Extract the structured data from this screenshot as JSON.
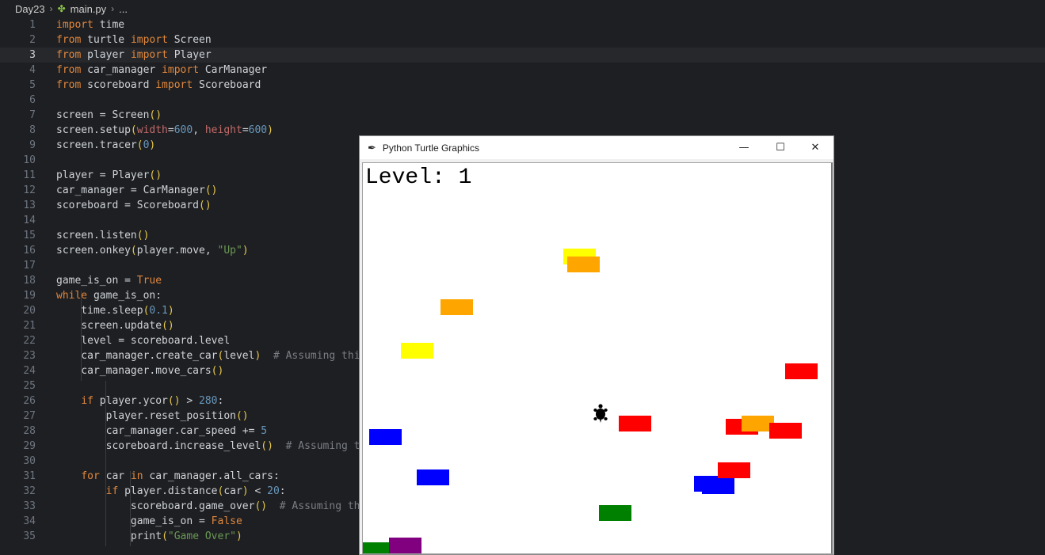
{
  "breadcrumb": {
    "folder": "Day23",
    "file": "main.py",
    "more": "..."
  },
  "editor": {
    "current_line": 3,
    "lines": [
      [
        [
          "import",
          "kw"
        ],
        [
          " time",
          ""
        ]
      ],
      [
        [
          "from",
          "kw"
        ],
        [
          " turtle ",
          ""
        ],
        [
          "import",
          "kw"
        ],
        [
          " Screen",
          ""
        ]
      ],
      [
        [
          "from",
          "kw"
        ],
        [
          " player ",
          ""
        ],
        [
          "import",
          "kw"
        ],
        [
          " Player",
          ""
        ]
      ],
      [
        [
          "from",
          "kw"
        ],
        [
          " car_manager ",
          ""
        ],
        [
          "import",
          "kw"
        ],
        [
          " CarManager",
          ""
        ]
      ],
      [
        [
          "from",
          "kw"
        ],
        [
          " scoreboard ",
          ""
        ],
        [
          "import",
          "kw"
        ],
        [
          " Scoreboard",
          ""
        ]
      ],
      [],
      [
        [
          "screen = Screen",
          ""
        ],
        [
          "()",
          "par"
        ]
      ],
      [
        [
          "screen.setup",
          ""
        ],
        [
          "(",
          "par"
        ],
        [
          "width",
          "prm"
        ],
        [
          "=",
          ""
        ],
        [
          "600",
          "num"
        ],
        [
          ", ",
          ""
        ],
        [
          "height",
          "prm"
        ],
        [
          "=",
          ""
        ],
        [
          "600",
          "num"
        ],
        [
          ")",
          "par"
        ]
      ],
      [
        [
          "screen.tracer",
          ""
        ],
        [
          "(",
          "par"
        ],
        [
          "0",
          "num"
        ],
        [
          ")",
          "par"
        ]
      ],
      [],
      [
        [
          "player = Player",
          ""
        ],
        [
          "()",
          "par"
        ]
      ],
      [
        [
          "car_manager = CarManager",
          ""
        ],
        [
          "()",
          "par"
        ]
      ],
      [
        [
          "scoreboard = Scoreboard",
          ""
        ],
        [
          "()",
          "par"
        ]
      ],
      [],
      [
        [
          "screen.listen",
          ""
        ],
        [
          "()",
          "par"
        ]
      ],
      [
        [
          "screen.onkey",
          ""
        ],
        [
          "(",
          "par"
        ],
        [
          "player.move, ",
          ""
        ],
        [
          "\"Up\"",
          "str"
        ],
        [
          ")",
          "par"
        ]
      ],
      [],
      [
        [
          "game_is_on = ",
          ""
        ],
        [
          "True",
          "kw"
        ]
      ],
      [
        [
          "while",
          "kw"
        ],
        [
          " game_is_on:",
          ""
        ]
      ],
      [
        [
          "    time.sleep",
          ""
        ],
        [
          "(",
          "par"
        ],
        [
          "0.1",
          "num"
        ],
        [
          ")",
          "par"
        ]
      ],
      [
        [
          "    screen.update",
          ""
        ],
        [
          "()",
          "par"
        ]
      ],
      [
        [
          "    level = scoreboard.level",
          ""
        ]
      ],
      [
        [
          "    car_manager.create_car",
          ""
        ],
        [
          "(",
          "par"
        ],
        [
          "level",
          ""
        ],
        [
          ")",
          "par"
        ],
        [
          "  # Assuming this",
          "cmt"
        ]
      ],
      [
        [
          "    car_manager.move_cars",
          ""
        ],
        [
          "()",
          "par"
        ]
      ],
      [],
      [
        [
          "    ",
          ""
        ],
        [
          "if",
          "kw"
        ],
        [
          " player.ycor",
          ""
        ],
        [
          "()",
          "par"
        ],
        [
          " > ",
          ""
        ],
        [
          "280",
          "num"
        ],
        [
          ":",
          ""
        ]
      ],
      [
        [
          "        player.reset_position",
          ""
        ],
        [
          "()",
          "par"
        ]
      ],
      [
        [
          "        car_manager.car_speed += ",
          ""
        ],
        [
          "5",
          "num"
        ]
      ],
      [
        [
          "        scoreboard.increase_level",
          ""
        ],
        [
          "()",
          "par"
        ],
        [
          "  # Assuming th",
          "cmt"
        ]
      ],
      [],
      [
        [
          "    ",
          ""
        ],
        [
          "for",
          "kw"
        ],
        [
          " car ",
          ""
        ],
        [
          "in",
          "kw"
        ],
        [
          " car_manager.all_cars:",
          ""
        ]
      ],
      [
        [
          "        ",
          ""
        ],
        [
          "if",
          "kw"
        ],
        [
          " player.distance",
          ""
        ],
        [
          "(",
          "par"
        ],
        [
          "car",
          ""
        ],
        [
          ")",
          "par"
        ],
        [
          " < ",
          ""
        ],
        [
          "20",
          "num"
        ],
        [
          ":",
          ""
        ]
      ],
      [
        [
          "            scoreboard.game_over",
          ""
        ],
        [
          "()",
          "par"
        ],
        [
          "  # Assuming thi",
          "cmt"
        ]
      ],
      [
        [
          "            game_is_on = ",
          ""
        ],
        [
          "False",
          "kw"
        ]
      ],
      [
        [
          "            print",
          ""
        ],
        [
          "(",
          "par"
        ],
        [
          "\"Game Over\"",
          "str"
        ],
        [
          ")",
          "par"
        ]
      ]
    ]
  },
  "turtle_window": {
    "title": "Python Turtle Graphics",
    "minimize": "—",
    "maximize": "☐",
    "close": "✕",
    "level_text": "Level: 1"
  },
  "cars": [
    {
      "color": "yellow",
      "shade": "#ffff00"
    },
    {
      "color": "orange",
      "shade": "#ffa500"
    },
    {
      "color": "orange",
      "shade": "#ffa500"
    },
    {
      "color": "yellow",
      "shade": "#ffff00"
    },
    {
      "color": "red",
      "shade": "#ff0000"
    },
    {
      "color": "red",
      "shade": "#ff0000"
    },
    {
      "color": "red",
      "shade": "#ff0000"
    },
    {
      "color": "orange",
      "shade": "#ffa500"
    },
    {
      "color": "red",
      "shade": "#ff0000"
    },
    {
      "color": "blue",
      "shade": "#0000ff"
    },
    {
      "color": "blue",
      "shade": "#0000ff"
    },
    {
      "color": "blue",
      "shade": "#0000ff"
    },
    {
      "color": "blue",
      "shade": "#0000ff"
    },
    {
      "color": "red",
      "shade": "#ff0000"
    },
    {
      "color": "green",
      "shade": "#008000"
    },
    {
      "color": "green",
      "shade": "#008000"
    },
    {
      "color": "purple",
      "shade": "#800080"
    }
  ],
  "player_icon": "turtle-icon"
}
